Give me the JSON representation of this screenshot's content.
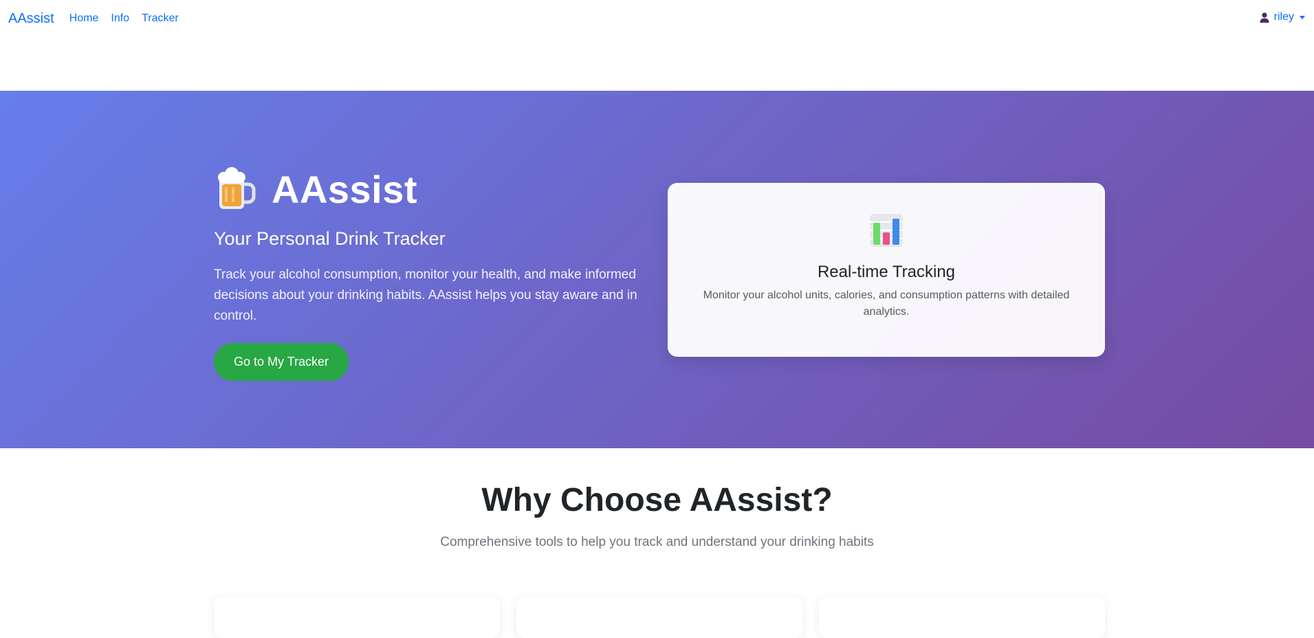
{
  "navbar": {
    "brand": "AAssist",
    "links": [
      "Home",
      "Info",
      "Tracker"
    ],
    "user": "riley",
    "icons": {
      "user": "user-icon",
      "dropdown": "caret-down-icon"
    }
  },
  "hero": {
    "icon": "beer-mug-icon",
    "title": "AAssist",
    "subtitle": "Your Personal Drink Tracker",
    "description": "Track your alcohol consumption, monitor your health, and make informed decisions about your drinking habits. AAssist helps you stay aware and in control.",
    "cta_label": "Go to My Tracker",
    "feature": {
      "icon": "bar-chart-icon",
      "title": "Real-time Tracking",
      "description": "Monitor your alcohol units, calories, and consumption patterns with detailed analytics."
    }
  },
  "why": {
    "title": "Why Choose AAssist?",
    "subtitle": "Comprehensive tools to help you track and understand your drinking habits"
  },
  "colors": {
    "link": "#0d6efd",
    "gradient_start": "#667eea",
    "gradient_end": "#764ba2",
    "cta": "#28a745"
  }
}
